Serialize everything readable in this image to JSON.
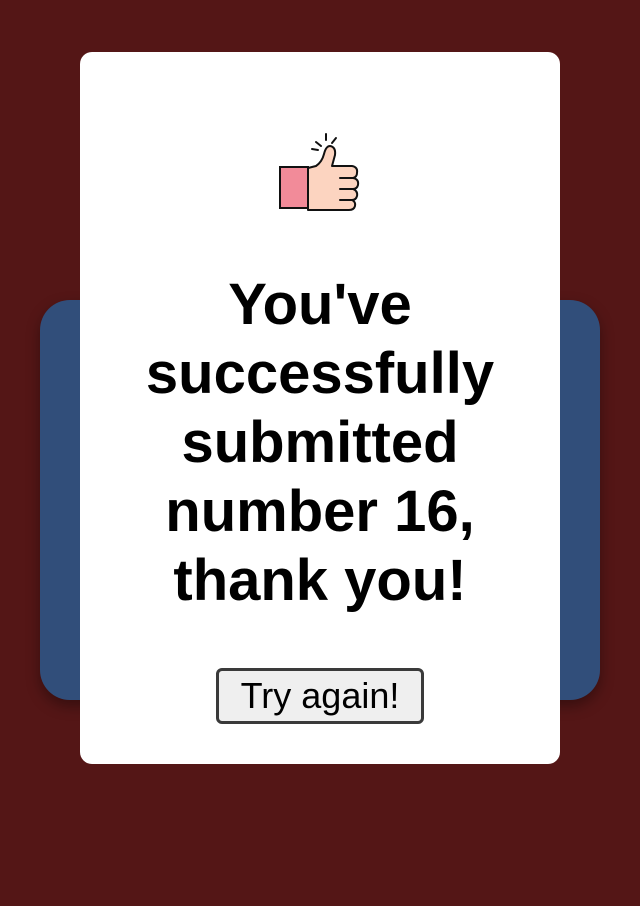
{
  "page": {
    "background_color": "#541616",
    "back_panel_color": "#314e7a",
    "card_color": "#ffffff"
  },
  "card": {
    "icon": "thumbs-up-icon",
    "message": "You've successfully submitted number 16, thank you!",
    "button_label": "Try again!"
  }
}
